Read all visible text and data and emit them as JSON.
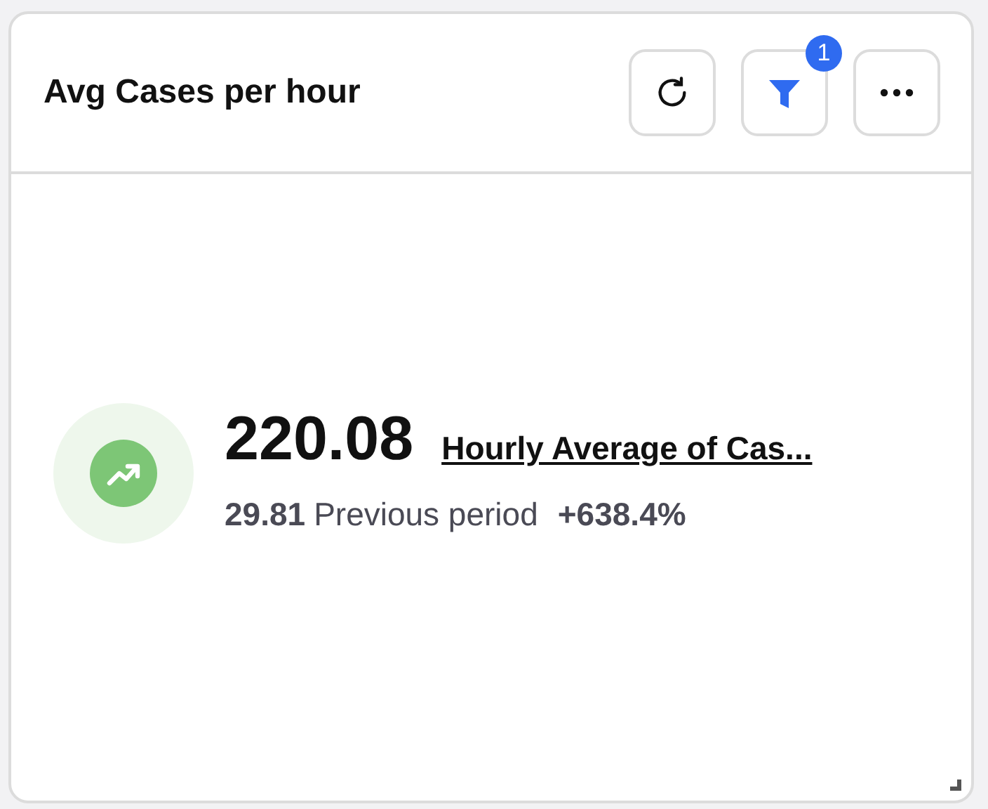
{
  "card": {
    "title": "Avg Cases per hour",
    "actions": [
      {
        "kind": "refresh"
      },
      {
        "kind": "filter",
        "badge": "1"
      },
      {
        "kind": "more"
      }
    ],
    "metric": {
      "value": "220.08",
      "label": "Hourly Average of Cas...",
      "previous_value": "29.81",
      "previous_label": "Previous period",
      "change": "+638.4%"
    }
  }
}
